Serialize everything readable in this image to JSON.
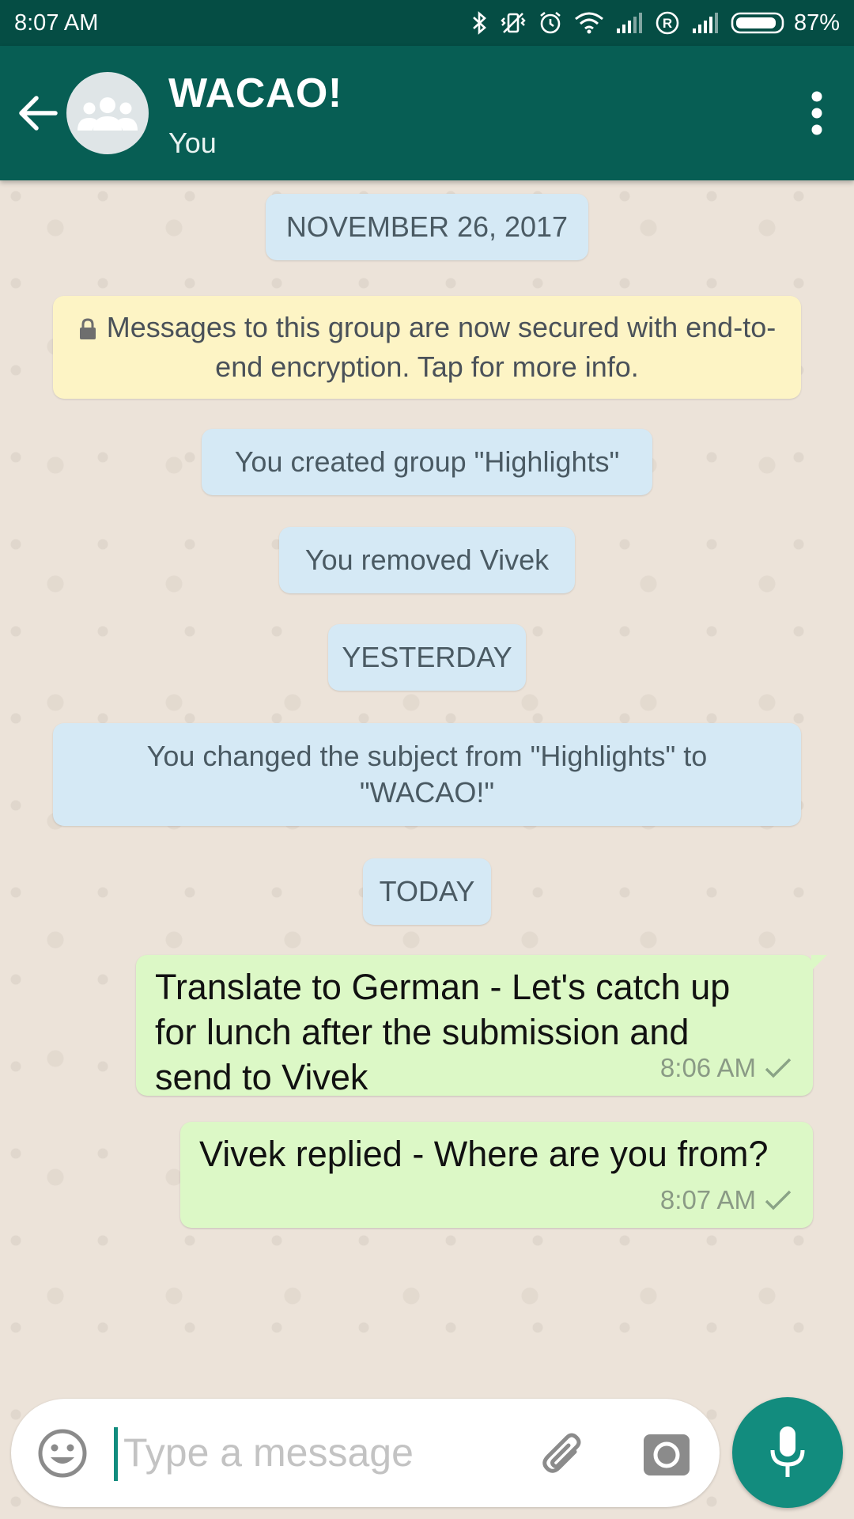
{
  "status_bar": {
    "time": "8:07 AM",
    "battery": "87%",
    "icons": [
      "bluetooth-icon",
      "vibrate-icon",
      "alarm-icon",
      "wifi-icon",
      "signal-icon",
      "roaming-icon",
      "signal-icon",
      "battery-icon"
    ]
  },
  "header": {
    "title": "WACAO!",
    "subtitle": "You",
    "icons": [
      "back-arrow-icon",
      "group-avatar-icon",
      "more-vert-icon"
    ]
  },
  "chat": {
    "date_nov": "NOVEMBER 26, 2017",
    "encryption_notice": "Messages to this group are now secured with end-to-end encryption. Tap for more info.",
    "created_group": "You created group \"Highlights\"",
    "removed_member": "You removed Vivek",
    "date_yesterday": "YESTERDAY",
    "subject_change": "You changed the subject from \"Highlights\" to \"WACAO!\"",
    "date_today": "TODAY",
    "messages": [
      {
        "text": "Translate to German - Let's catch up for lunch after the submission and send to Vivek",
        "time": "8:06 AM",
        "status": "sent"
      },
      {
        "text": "Vivek replied - Where are you from?",
        "time": "8:07 AM",
        "status": "sent"
      }
    ]
  },
  "input_bar": {
    "placeholder": "Type a message",
    "value": "",
    "icons": [
      "emoji-icon",
      "attach-icon",
      "camera-icon",
      "mic-icon"
    ]
  },
  "colors": {
    "status_bar": "#054d44",
    "app_bar": "#075e54",
    "accent": "#128c7e",
    "outgoing_bubble": "#dcf8c6",
    "system_pill": "#d5e9f5",
    "encryption_notice": "#fdf4c5"
  }
}
